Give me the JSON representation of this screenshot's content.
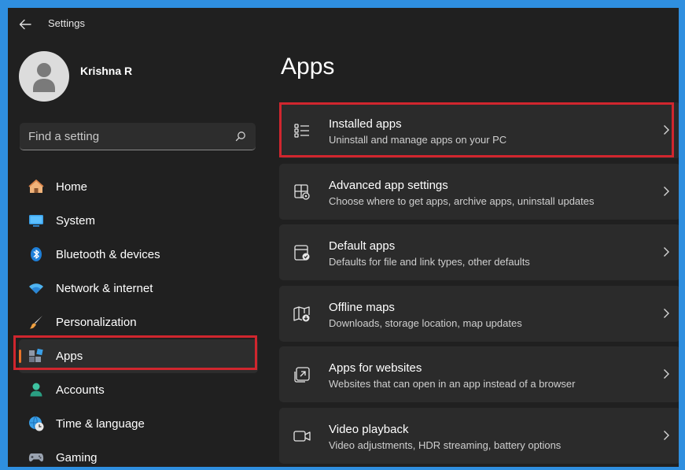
{
  "window": {
    "title": "Settings"
  },
  "profile": {
    "name": "Krishna R"
  },
  "search": {
    "placeholder": "Find a setting"
  },
  "sidebar": {
    "items": [
      {
        "label": "Home",
        "icon": "home-icon"
      },
      {
        "label": "System",
        "icon": "system-icon"
      },
      {
        "label": "Bluetooth & devices",
        "icon": "bluetooth-icon"
      },
      {
        "label": "Network & internet",
        "icon": "wifi-icon"
      },
      {
        "label": "Personalization",
        "icon": "brush-icon"
      },
      {
        "label": "Apps",
        "icon": "apps-icon",
        "selected": true
      },
      {
        "label": "Accounts",
        "icon": "accounts-icon"
      },
      {
        "label": "Time & language",
        "icon": "globe-clock-icon"
      },
      {
        "label": "Gaming",
        "icon": "gamepad-icon"
      }
    ]
  },
  "main": {
    "title": "Apps",
    "cards": [
      {
        "title": "Installed apps",
        "subtitle": "Uninstall and manage apps on your PC",
        "icon": "list-icon"
      },
      {
        "title": "Advanced app settings",
        "subtitle": "Choose where to get apps, archive apps, uninstall updates",
        "icon": "app-settings-icon"
      },
      {
        "title": "Default apps",
        "subtitle": "Defaults for file and link types, other defaults",
        "icon": "default-apps-icon"
      },
      {
        "title": "Offline maps",
        "subtitle": "Downloads, storage location, map updates",
        "icon": "map-download-icon"
      },
      {
        "title": "Apps for websites",
        "subtitle": "Websites that can open in an app instead of a browser",
        "icon": "open-in-app-icon"
      },
      {
        "title": "Video playback",
        "subtitle": "Video adjustments, HDR streaming, battery options",
        "icon": "video-icon"
      }
    ]
  },
  "colors": {
    "accent": "#e8742a",
    "highlight_box": "#d0262e",
    "frame": "#2f8fe0",
    "background": "#202020",
    "card": "#2b2b2b"
  }
}
